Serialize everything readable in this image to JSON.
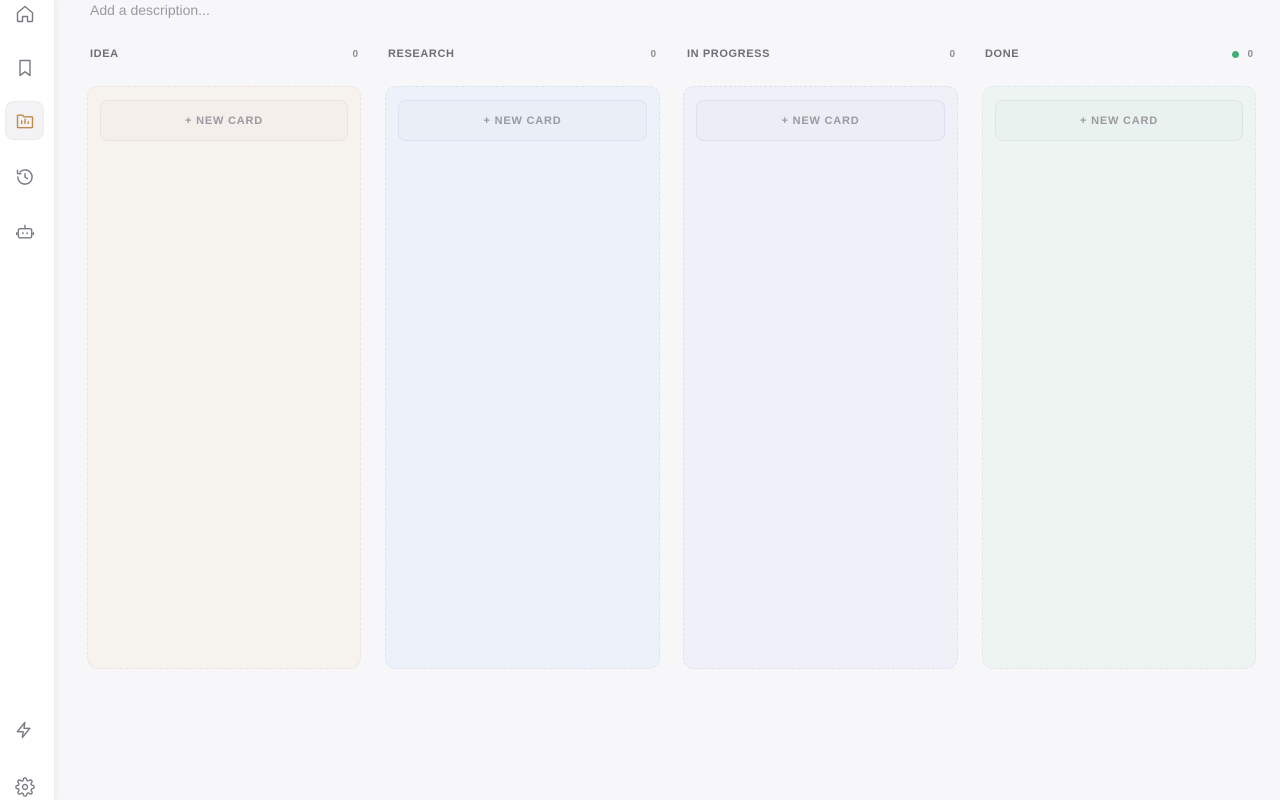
{
  "sidebar": {
    "items": [
      {
        "name": "home",
        "icon": "home-icon"
      },
      {
        "name": "bookmarks",
        "icon": "bookmark-icon"
      },
      {
        "name": "board",
        "icon": "folder-chart-icon",
        "active": true
      },
      {
        "name": "history",
        "icon": "history-icon"
      },
      {
        "name": "bot",
        "icon": "robot-icon"
      }
    ],
    "bottom_items": [
      {
        "name": "automations",
        "icon": "lightning-icon"
      },
      {
        "name": "settings",
        "icon": "gear-icon"
      }
    ],
    "active_color": "#c08a4a"
  },
  "board": {
    "description_placeholder": "Add a description...",
    "columns": [
      {
        "title": "IDEA",
        "count": "0",
        "new_card_label": "+ NEW CARD",
        "bg": "#f6f2ee",
        "border": "#ece4da",
        "card_bg": "#f4efea",
        "card_border": "#ebe3da"
      },
      {
        "title": "RESEARCH",
        "count": "0",
        "new_card_label": "+ NEW CARD",
        "bg": "#edf1f9",
        "border": "#dde4f1",
        "card_bg": "#eaeef7",
        "card_border": "#dce3ef"
      },
      {
        "title": "IN PROGRESS",
        "count": "0",
        "new_card_label": "+ NEW CARD",
        "bg": "#f0f0f8",
        "border": "#e0e0ee",
        "card_bg": "#ededf6",
        "card_border": "#dedeec"
      },
      {
        "title": "DONE",
        "count": "0",
        "new_card_label": "+ NEW CARD",
        "bg": "#edf4f2",
        "border": "#dce9e5",
        "card_bg": "#eaf2ef",
        "card_border": "#d9e7e2",
        "status_dot": "#3fae72"
      }
    ]
  }
}
